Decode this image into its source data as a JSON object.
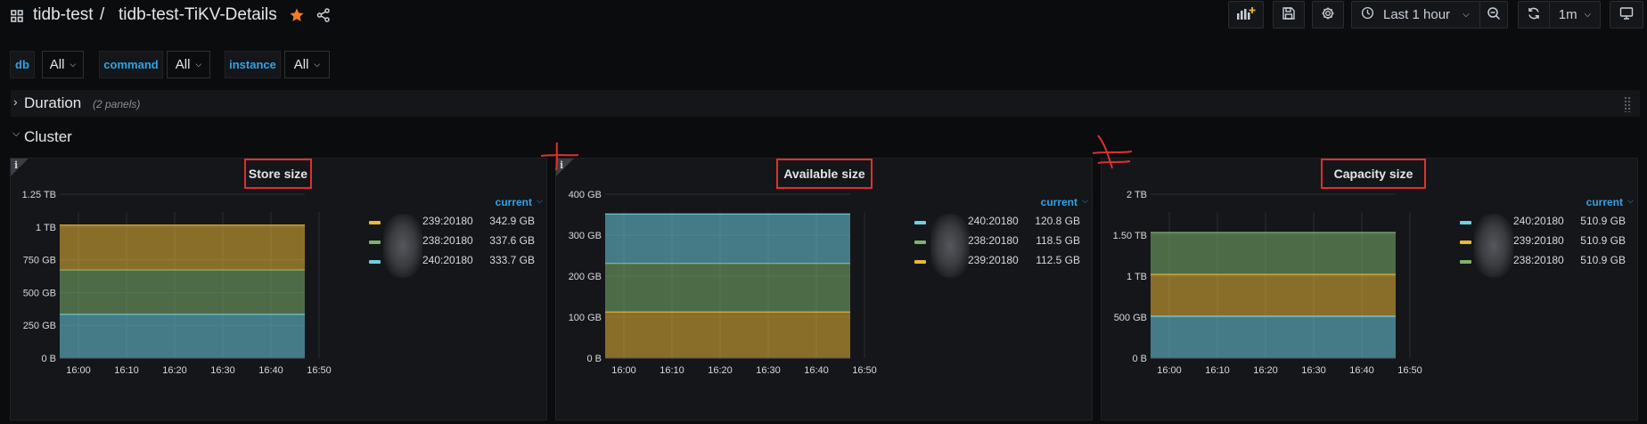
{
  "breadcrumb": {
    "folder": "tidb-test",
    "separator": "/",
    "dashboard": "tidb-test-TiKV-Details"
  },
  "toolbar": {
    "time_range": "Last 1 hour",
    "refresh_interval": "1m"
  },
  "variables": [
    {
      "label": "db",
      "value": "All"
    },
    {
      "label": "command",
      "value": "All"
    },
    {
      "label": "instance",
      "value": "All"
    }
  ],
  "rows": {
    "duration": {
      "title": "Duration",
      "count": "(2 panels)"
    },
    "cluster": {
      "title": "Cluster"
    }
  },
  "colors": {
    "cyan": "#6ed0e0",
    "green": "#7eb26d",
    "yellow": "#eab839",
    "accent": "#33a2e5",
    "highlight": "#e02f2f"
  },
  "panels": [
    {
      "title": "Store size",
      "legend_header": "current",
      "legend": [
        {
          "name": "239:20180",
          "value": "342.9 GB",
          "color": "#eab839"
        },
        {
          "name": "238:20180",
          "value": "337.6 GB",
          "color": "#7eb26d"
        },
        {
          "name": "240:20180",
          "value": "333.7 GB",
          "color": "#6ed0e0"
        }
      ]
    },
    {
      "title": "Available size",
      "legend_header": "current",
      "legend": [
        {
          "name": "240:20180",
          "value": "120.8 GB",
          "color": "#6ed0e0"
        },
        {
          "name": "238:20180",
          "value": "118.5 GB",
          "color": "#7eb26d"
        },
        {
          "name": "239:20180",
          "value": "112.5 GB",
          "color": "#eab839"
        }
      ]
    },
    {
      "title": "Capacity size",
      "legend_header": "current",
      "legend": [
        {
          "name": "240:20180",
          "value": "510.9 GB",
          "color": "#6ed0e0"
        },
        {
          "name": "239:20180",
          "value": "510.9 GB",
          "color": "#eab839"
        },
        {
          "name": "238:20180",
          "value": "510.9 GB",
          "color": "#7eb26d"
        }
      ]
    }
  ],
  "chart_data": [
    {
      "type": "area",
      "title": "Store size",
      "stacked": true,
      "x": [
        "16:00",
        "16:10",
        "16:20",
        "16:30",
        "16:40",
        "16:50"
      ],
      "y_ticks": [
        "0 B",
        "250 GB",
        "500 GB",
        "750 GB",
        "1 TB",
        "1.25 TB"
      ],
      "ylim": [
        0,
        1250
      ],
      "y_unit": "GB",
      "series": [
        {
          "name": "239:20180",
          "value": 342.9,
          "color": "#eab839"
        },
        {
          "name": "238:20180",
          "value": 337.6,
          "color": "#7eb26d"
        },
        {
          "name": "240:20180",
          "value": 333.7,
          "color": "#6ed0e0"
        }
      ]
    },
    {
      "type": "area",
      "title": "Available size",
      "stacked": true,
      "x": [
        "16:00",
        "16:10",
        "16:20",
        "16:30",
        "16:40",
        "16:50"
      ],
      "y_ticks": [
        "0 B",
        "100 GB",
        "200 GB",
        "300 GB",
        "400 GB"
      ],
      "ylim": [
        0,
        400
      ],
      "y_unit": "GB",
      "series": [
        {
          "name": "240:20180",
          "value": 120.8,
          "color": "#6ed0e0"
        },
        {
          "name": "238:20180",
          "value": 118.5,
          "color": "#7eb26d"
        },
        {
          "name": "239:20180",
          "value": 112.5,
          "color": "#eab839"
        }
      ]
    },
    {
      "type": "area",
      "title": "Capacity size",
      "stacked": true,
      "x": [
        "16:00",
        "16:10",
        "16:20",
        "16:30",
        "16:40",
        "16:50"
      ],
      "y_ticks": [
        "0 B",
        "500 GB",
        "1 TB",
        "1.50 TB",
        "2 TB"
      ],
      "ylim": [
        0,
        2000
      ],
      "y_unit": "GB",
      "series": [
        {
          "name": "238:20180",
          "value": 510.9,
          "color": "#7eb26d"
        },
        {
          "name": "239:20180",
          "value": 510.9,
          "color": "#eab839"
        },
        {
          "name": "240:20180",
          "value": 510.9,
          "color": "#6ed0e0"
        }
      ]
    }
  ]
}
